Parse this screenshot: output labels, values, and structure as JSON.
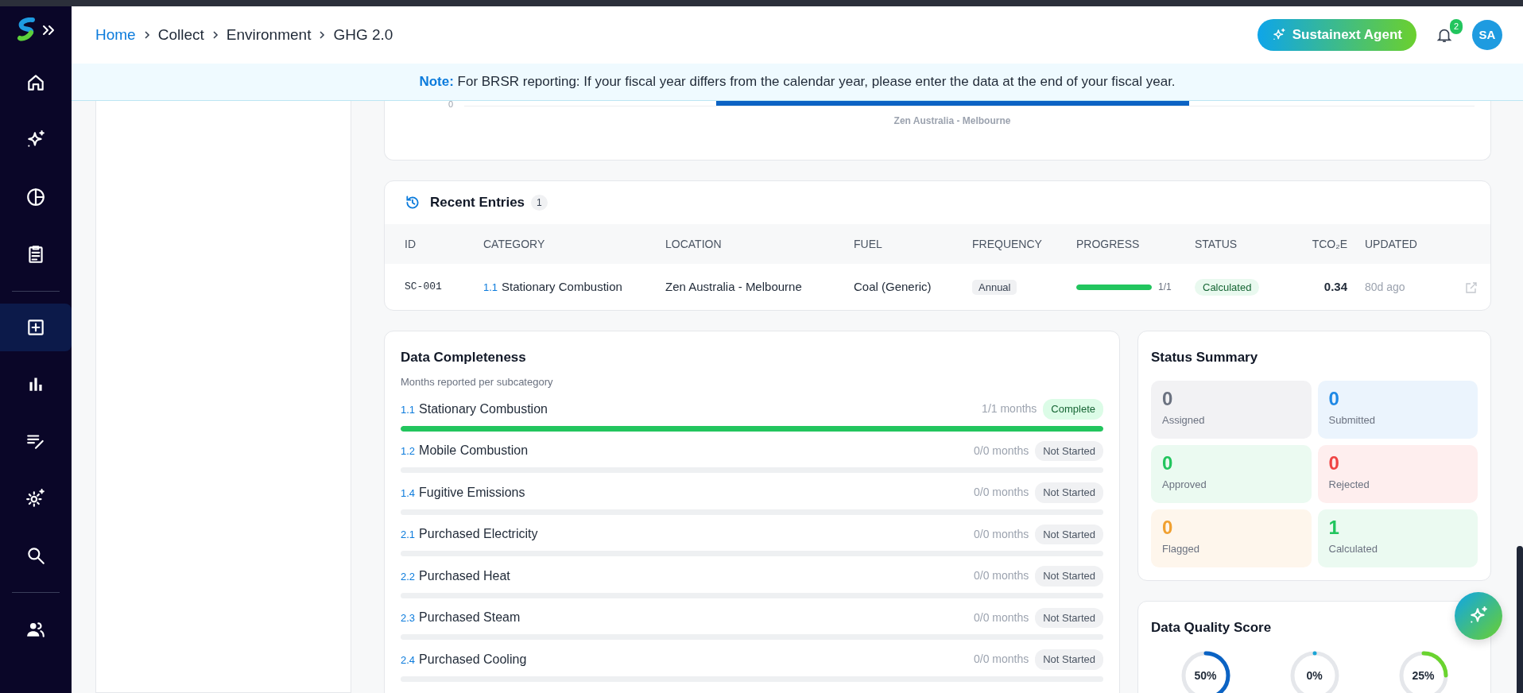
{
  "sidebar": {
    "items": [
      {
        "kind": "item",
        "selected": false
      },
      {
        "kind": "item",
        "selected": false
      },
      {
        "kind": "item",
        "selected": false
      },
      {
        "kind": "item",
        "selected": false
      },
      {
        "kind": "divider"
      },
      {
        "kind": "item",
        "selected": true
      },
      {
        "kind": "item",
        "selected": false
      },
      {
        "kind": "item",
        "selected": false
      },
      {
        "kind": "item",
        "selected": false
      },
      {
        "kind": "item",
        "selected": false
      },
      {
        "kind": "divider"
      },
      {
        "kind": "item",
        "selected": false
      }
    ]
  },
  "breadcrumb": [
    {
      "label": "Home",
      "link": true
    },
    {
      "label": "Collect",
      "link": false
    },
    {
      "label": "Environment",
      "link": false
    },
    {
      "label": "GHG 2.0",
      "link": false
    }
  ],
  "header": {
    "agent_button": "Sustainext Agent",
    "notifications": "2",
    "avatar": "SA"
  },
  "note": {
    "label": "Note:",
    "text": "For BRSR reporting: If your fiscal year differs from the calendar year, please enter the data at the end of your fiscal year."
  },
  "chart_fragment": {
    "ytick": "0",
    "category": "Zen Australia - Melbourne"
  },
  "recent_entries": {
    "title": "Recent Entries",
    "count": "1",
    "columns": [
      "ID",
      "CATEGORY",
      "LOCATION",
      "FUEL",
      "FREQUENCY",
      "PROGRESS",
      "STATUS",
      "TCO₂E",
      "UPDATED"
    ],
    "rows": [
      {
        "id": "SC-001",
        "code": "1.1",
        "category": "Stationary Combustion",
        "location": "Zen Australia - Melbourne",
        "fuel": "Coal (Generic)",
        "frequency": "Annual",
        "level": 1,
        "progress": "1/1",
        "status": "Calculated",
        "tco2e": "0.34",
        "updated": "80d ago"
      }
    ]
  },
  "completeness": {
    "title": "Data Completeness",
    "subtitle": "Months reported per subcategory",
    "items": [
      {
        "code": "1.1",
        "name": "Stationary Combustion",
        "months": "1/1 months",
        "status": "Complete",
        "kind": "complete",
        "level": 1
      },
      {
        "code": "1.2",
        "name": "Mobile Combustion",
        "months": "0/0 months",
        "status": "Not Started",
        "kind": "not_started",
        "level": 0
      },
      {
        "code": "1.4",
        "name": "Fugitive Emissions",
        "months": "0/0 months",
        "status": "Not Started",
        "kind": "not_started",
        "level": 0
      },
      {
        "code": "2.1",
        "name": "Purchased Electricity",
        "months": "0/0 months",
        "status": "Not Started",
        "kind": "not_started",
        "level": 0
      },
      {
        "code": "2.2",
        "name": "Purchased Heat",
        "months": "0/0 months",
        "status": "Not Started",
        "kind": "not_started",
        "level": 0
      },
      {
        "code": "2.3",
        "name": "Purchased Steam",
        "months": "0/0 months",
        "status": "Not Started",
        "kind": "not_started",
        "level": 0
      },
      {
        "code": "2.4",
        "name": "Purchased Cooling",
        "months": "0/0 months",
        "status": "Not Started",
        "kind": "not_started",
        "level": 0
      }
    ]
  },
  "status_summary": {
    "title": "Status Summary",
    "tiles": [
      {
        "value": "0",
        "label": "Assigned",
        "color": "#6b7280"
      },
      {
        "value": "0",
        "label": "Submitted",
        "color": "#1e88e5"
      },
      {
        "value": "0",
        "label": "Approved",
        "color": "#22c55e"
      },
      {
        "value": "0",
        "label": "Rejected",
        "color": "#ef4444"
      },
      {
        "value": "0",
        "label": "Flagged",
        "color": "#f0a030"
      },
      {
        "value": "1",
        "label": "Calculated",
        "color": "#22c55e"
      }
    ]
  },
  "data_quality": {
    "title": "Data Quality Score",
    "scores": [
      {
        "label": "50%",
        "level": 0.5,
        "color": "#0b63c4"
      },
      {
        "label": "0%",
        "level": 0,
        "color": "#1aa5d6"
      },
      {
        "label": "25%",
        "level": 0.25,
        "color": "#6ad42f"
      }
    ]
  }
}
